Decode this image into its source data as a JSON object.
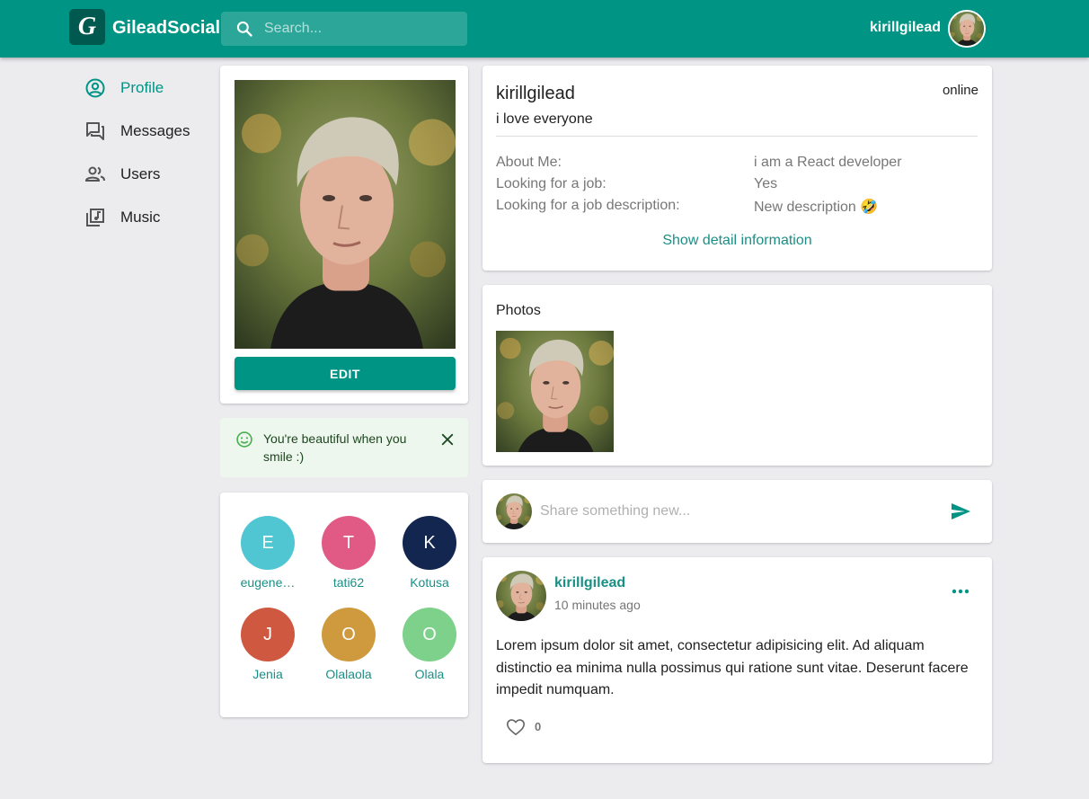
{
  "header": {
    "logo_letter": "G",
    "brand": "GileadSocial",
    "search_placeholder": "Search...",
    "username": "kirillgilead",
    "accent": "#009485"
  },
  "sidebar": {
    "items": [
      {
        "label": "Profile",
        "icon": "account-circle-icon",
        "active": true
      },
      {
        "label": "Messages",
        "icon": "forum-icon",
        "active": false
      },
      {
        "label": "Users",
        "icon": "people-icon",
        "active": false
      },
      {
        "label": "Music",
        "icon": "library-music-icon",
        "active": false
      }
    ]
  },
  "avatar_card": {
    "edit_label": "EDIT"
  },
  "alert": {
    "message": "You're beautiful when you smile :)",
    "color": "#edf7ed"
  },
  "friends": [
    {
      "initial": "E",
      "name": "eugene…",
      "color": "#4fc6d2"
    },
    {
      "initial": "T",
      "name": "tati62",
      "color": "#e05a85"
    },
    {
      "initial": "K",
      "name": "Kotusa",
      "color": "#122650"
    },
    {
      "initial": "J",
      "name": "Jenia",
      "color": "#cf5840"
    },
    {
      "initial": "O",
      "name": "Olalaola",
      "color": "#cf9a3d"
    },
    {
      "initial": "O",
      "name": "Olala",
      "color": "#7dd18a"
    }
  ],
  "profile": {
    "name": "kirillgilead",
    "status": "i love everyone",
    "online": "online",
    "about_label": "About Me:",
    "about_value": "i am a React developer",
    "job_label": "Looking for a job:",
    "job_value": "Yes",
    "job_desc_label": "Looking for a job description:",
    "job_desc_value": "New description 🤣",
    "detail_link": "Show detail information"
  },
  "photos": {
    "title": "Photos"
  },
  "share": {
    "placeholder": "Share something new..."
  },
  "post": {
    "author": "kirillgilead",
    "time": "10 minutes ago",
    "text": "Lorem ipsum dolor sit amet, consectetur adipisicing elit. Ad aliquam distinctio ea minima nulla possimus qui ratione sunt vitae. Deserunt facere impedit numquam.",
    "likes": "0"
  }
}
